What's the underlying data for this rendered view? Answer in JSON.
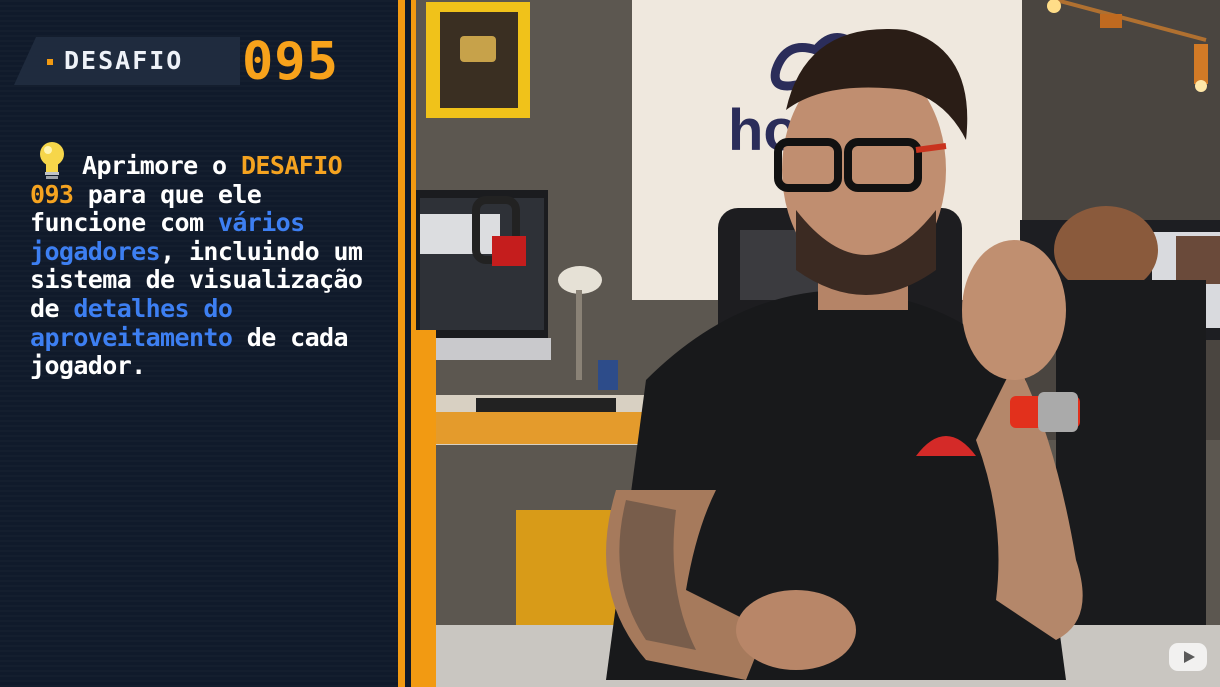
{
  "header": {
    "label": "DESAFIO",
    "number": "095"
  },
  "challenge_text": {
    "part1": "Aprimore o ",
    "highlight1": "DESAFIO 093",
    "part2": " para que ele funcione com ",
    "highlight2": "vários jogadores",
    "part3": ", incluindo um sistema de visualização de ",
    "highlight3": "detalhes do aproveitamento",
    "part4": " de cada jogador."
  },
  "icons": {
    "bulb": "lightbulb-icon",
    "watermark": "youtube-play-icon"
  },
  "colors": {
    "accent_orange": "#f29a12",
    "highlight_blue": "#3d7ff2",
    "panel_bg": "#101a2b"
  }
}
